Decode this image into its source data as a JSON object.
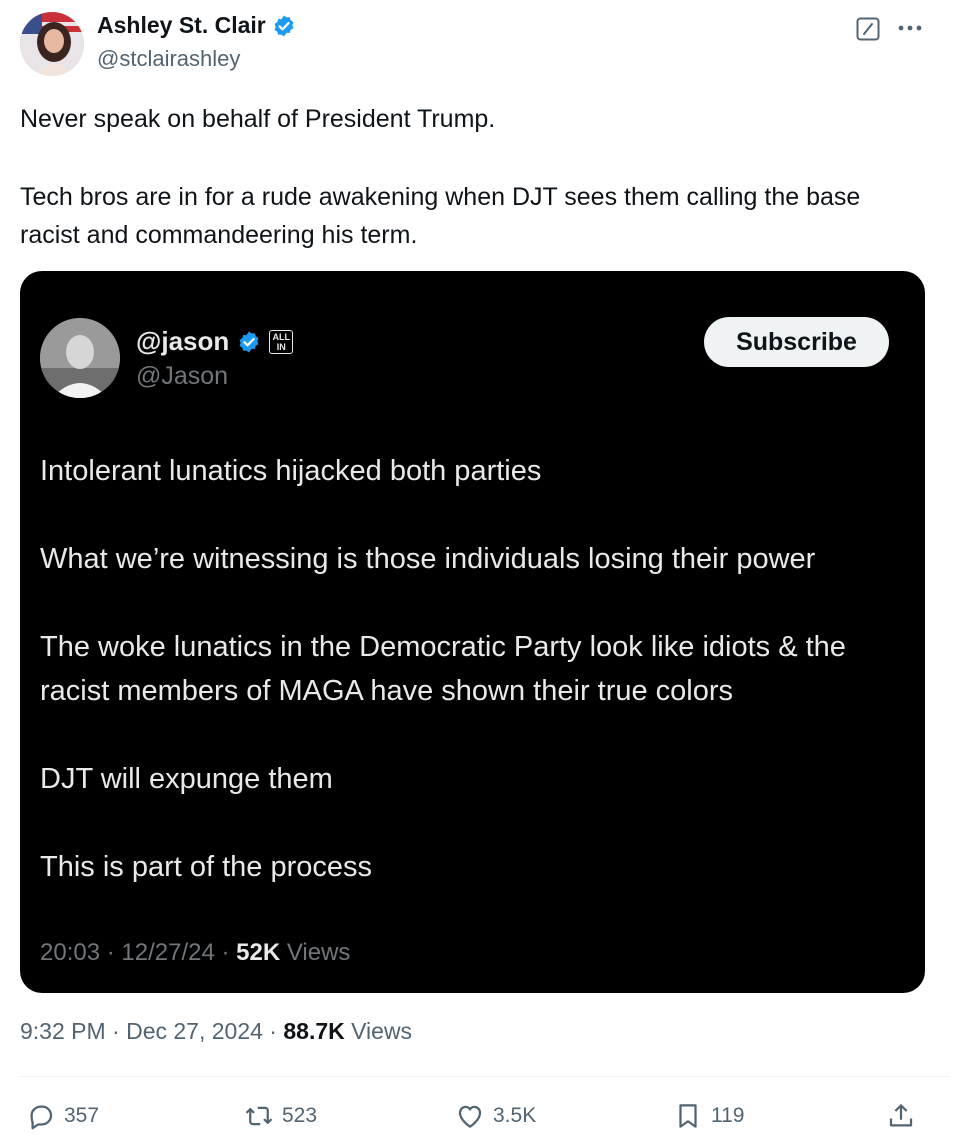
{
  "author": {
    "display_name": "Ashley St. Clair",
    "handle": "@stclairashley",
    "verified_color": "#1d9bf0"
  },
  "header_icons": [
    "grok-icon",
    "more-icon"
  ],
  "tweet": {
    "line1": "Never speak on behalf of President Trump.",
    "line2": "Tech bros are in for a rude awakening when DJT sees them calling the base racist and commandeering his term."
  },
  "quoted_image": {
    "name": "@jason",
    "handle": "@Jason",
    "badge_text": "ALL IN",
    "subscribe_label": "Subscribe",
    "paragraphs": [
      "Intolerant lunatics hijacked both parties",
      "What we’re witnessing is those individuals losing their power",
      "The woke lunatics in the Democratic Party look like idiots & the racist members of MAGA have shown their true colors",
      "DJT will expunge them",
      "This is part of the process"
    ],
    "time": "20:03 · 12/27/24 · ",
    "views_count": "52K",
    "views_label": "Views"
  },
  "meta": {
    "time": "9:32 PM · Dec 27, 2024 · ",
    "views_count": "88.7K",
    "views_label": "Views"
  },
  "actions": {
    "replies": "357",
    "reposts": "523",
    "likes": "3.5K",
    "bookmarks": "119"
  }
}
